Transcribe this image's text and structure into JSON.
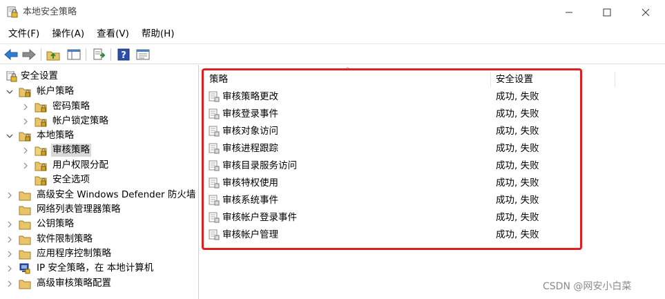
{
  "window": {
    "title": "本地安全策略"
  },
  "menu": [
    "文件(F)",
    "操作(A)",
    "查看(V)",
    "帮助(H)"
  ],
  "toolbar": [
    {
      "icon": "back-arrow-icon"
    },
    {
      "icon": "forward-arrow-icon"
    },
    {
      "icon": "up-folder-icon"
    },
    {
      "icon": "show-tree-icon"
    },
    {
      "icon": "export-list-icon"
    },
    {
      "icon": "help-icon"
    },
    {
      "icon": "properties-icon"
    }
  ],
  "tree": [
    {
      "label": "安全设置",
      "level": 0,
      "icon": "security-settings-icon",
      "expander": "none"
    },
    {
      "label": "帐户策略",
      "level": 1,
      "icon": "folder-lock-icon",
      "expander": "expanded"
    },
    {
      "label": "密码策略",
      "level": 2,
      "icon": "folder-lock-icon",
      "expander": "collapsed"
    },
    {
      "label": "帐户锁定策略",
      "level": 2,
      "icon": "folder-lock-icon",
      "expander": "collapsed"
    },
    {
      "label": "本地策略",
      "level": 1,
      "icon": "folder-lock-icon",
      "expander": "expanded"
    },
    {
      "label": "审核策略",
      "level": 2,
      "icon": "folder-lock-icon",
      "expander": "collapsed",
      "selected": true
    },
    {
      "label": "用户权限分配",
      "level": 2,
      "icon": "folder-lock-icon",
      "expander": "collapsed"
    },
    {
      "label": "安全选项",
      "level": 2,
      "icon": "folder-lock-icon",
      "expander": "none"
    },
    {
      "label": "高级安全 Windows Defender 防火墙",
      "level": 1,
      "icon": "folder-icon",
      "expander": "collapsed"
    },
    {
      "label": "网络列表管理器策略",
      "level": 1,
      "icon": "folder-icon",
      "expander": "none"
    },
    {
      "label": "公钥策略",
      "level": 1,
      "icon": "folder-icon",
      "expander": "collapsed"
    },
    {
      "label": "软件限制策略",
      "level": 1,
      "icon": "folder-icon",
      "expander": "collapsed"
    },
    {
      "label": "应用程序控制策略",
      "level": 1,
      "icon": "folder-icon",
      "expander": "collapsed"
    },
    {
      "label": "IP 安全策略，在 本地计算机",
      "level": 1,
      "icon": "ip-security-icon",
      "expander": "collapsed"
    },
    {
      "label": "高级审核策略配置",
      "level": 1,
      "icon": "folder-icon",
      "expander": "collapsed"
    }
  ],
  "list": {
    "columns": [
      "策略",
      "安全设置"
    ],
    "rows": [
      {
        "policy": "审核策略更改",
        "setting": "成功, 失败"
      },
      {
        "policy": "审核登录事件",
        "setting": "成功, 失败"
      },
      {
        "policy": "审核对象访问",
        "setting": "成功, 失败"
      },
      {
        "policy": "审核进程跟踪",
        "setting": "成功, 失败"
      },
      {
        "policy": "审核目录服务访问",
        "setting": "成功, 失败"
      },
      {
        "policy": "审核特权使用",
        "setting": "成功, 失败"
      },
      {
        "policy": "审核系统事件",
        "setting": "成功, 失败"
      },
      {
        "policy": "审核帐户登录事件",
        "setting": "成功, 失败"
      },
      {
        "policy": "审核帐户管理",
        "setting": "成功, 失败"
      }
    ]
  },
  "watermark": "CSDN @网安小白菜",
  "colors": {
    "highlight": "#e02020",
    "folder": "#e8c56a",
    "selected": "#d9d9d9"
  }
}
